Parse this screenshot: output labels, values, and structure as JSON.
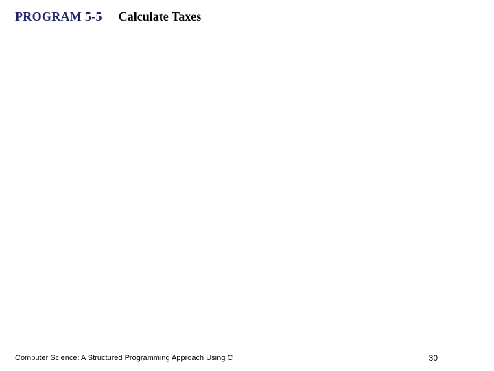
{
  "header": {
    "program_label": "PROGRAM 5-5",
    "program_title": "Calculate Taxes"
  },
  "footer": {
    "book_title": "Computer Science: A Structured Programming Approach Using C",
    "page_number": "30"
  }
}
